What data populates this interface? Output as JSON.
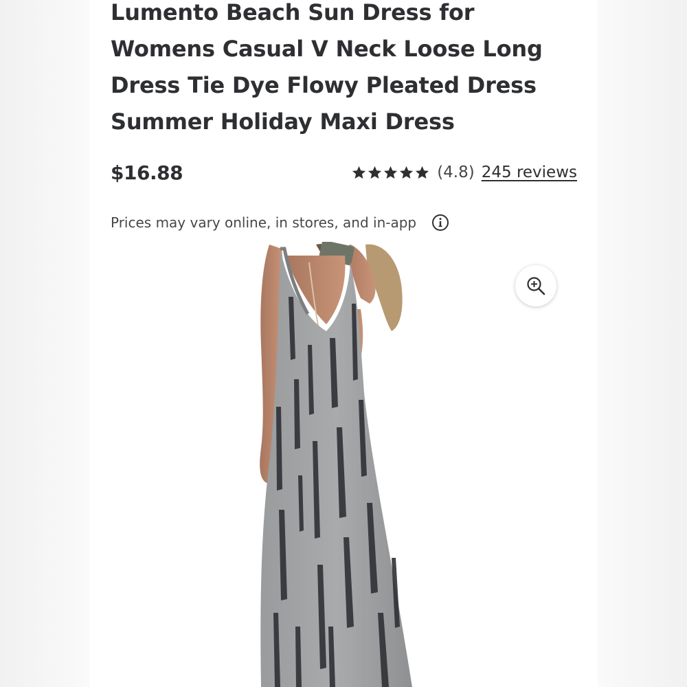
{
  "product": {
    "title": "Lumento Beach Sun Dress for Womens Casual V Neck Loose Long Dress Tie Dye Flowy Pleated Dress Summer Holiday Maxi Dress",
    "price": "$16.88",
    "rating_stars": 5,
    "rating_value": "(4.8)",
    "reviews_link": "245 reviews",
    "price_note": "Prices may vary online, in stores, and in-app"
  },
  "icons": {
    "stars": "star-icon",
    "info": "info-icon",
    "zoom": "zoom-in-icon"
  },
  "colors": {
    "text": "#2e2f32",
    "secondary_text": "#46474a",
    "dress": "#8f9092",
    "dress_dark_streaks": "#2f3136"
  }
}
